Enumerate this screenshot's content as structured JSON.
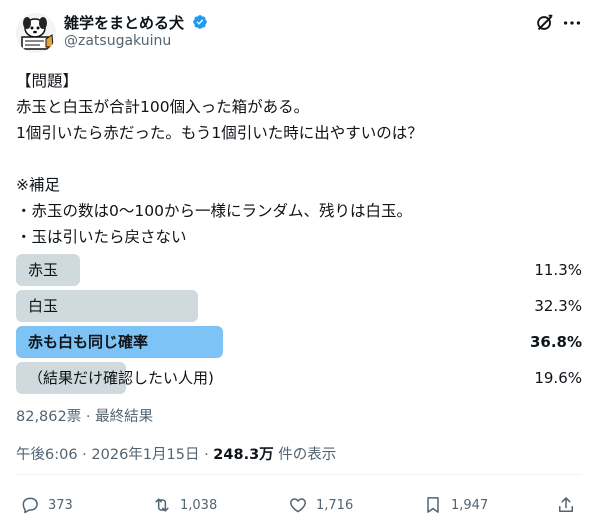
{
  "author": {
    "display_name": "雑学をまとめる犬",
    "handle": "@zatsugakuinu",
    "avatar_icon": "dog-avatar-icon",
    "verified_icon": "verified-badge-icon"
  },
  "tweet": {
    "text": "【問題】\n赤玉と白玉が合計100個入った箱がある。\n1個引いたら赤だった。もう1個引いた時に出やすいのは？\n\n※補足\n・赤玉の数は0～100から一様にランダム、残りは白玉。\n・玉は引いたら戻さない"
  },
  "poll": {
    "options": [
      {
        "label": "赤玉",
        "percent_label": "11.3%",
        "percent": 11.3,
        "winner": false
      },
      {
        "label": "白玉",
        "percent_label": "32.3%",
        "percent": 32.3,
        "winner": false
      },
      {
        "label": "赤も白も同じ確率",
        "percent_label": "36.8%",
        "percent": 36.8,
        "winner": true
      },
      {
        "label": "（結果だけ確認したい人用)",
        "percent_label": "19.6%",
        "percent": 19.6,
        "winner": false
      }
    ],
    "summary": "82,862票 · 最終結果",
    "bar_color": "#cfd9de",
    "winner_color": "#7ec3f5"
  },
  "meta": {
    "datetime": "午後6:06 · 2026年1月15日 · ",
    "views_count": "248.3万",
    "views_suffix": " 件の表示"
  },
  "actions": {
    "replies": "373",
    "retweets": "1,038",
    "likes": "1,716",
    "bookmarks": "1,947"
  },
  "icons": {
    "grok": "grok-icon",
    "more": "more-options-icon",
    "reply": "reply-icon",
    "retweet": "retweet-icon",
    "like": "heart-icon",
    "bookmark": "bookmark-icon",
    "share": "share-icon"
  }
}
